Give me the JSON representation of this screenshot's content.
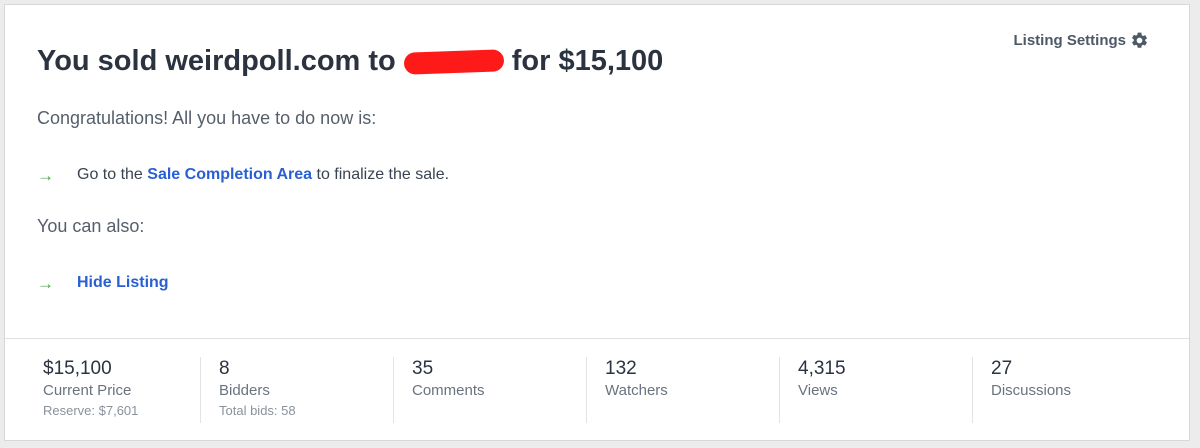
{
  "header": {
    "settings_label": "Listing Settings",
    "settings_icon": "gear-icon",
    "title_prefix": "You sold weirdpoll.com to",
    "title_suffix": "for $15,100"
  },
  "body": {
    "congrats": "Congratulations! All you have to do now is:",
    "step1": {
      "arrow": "→",
      "before": "Go to the",
      "link": "Sale Completion Area",
      "after": "to finalize the sale."
    },
    "also": "You can also:",
    "step2": {
      "arrow": "→",
      "link": "Hide Listing"
    }
  },
  "colors": {
    "link": "#2a5fd4",
    "arrow": "#46a840",
    "redaction": "#ff1a1a"
  },
  "stats": [
    {
      "value": "$15,100",
      "label": "Current Price",
      "sub": "Reserve: $7,601"
    },
    {
      "value": "8",
      "label": "Bidders",
      "sub": "Total bids: 58"
    },
    {
      "value": "35",
      "label": "Comments",
      "sub": ""
    },
    {
      "value": "132",
      "label": "Watchers",
      "sub": ""
    },
    {
      "value": "4,315",
      "label": "Views",
      "sub": ""
    },
    {
      "value": "27",
      "label": "Discussions",
      "sub": ""
    }
  ]
}
